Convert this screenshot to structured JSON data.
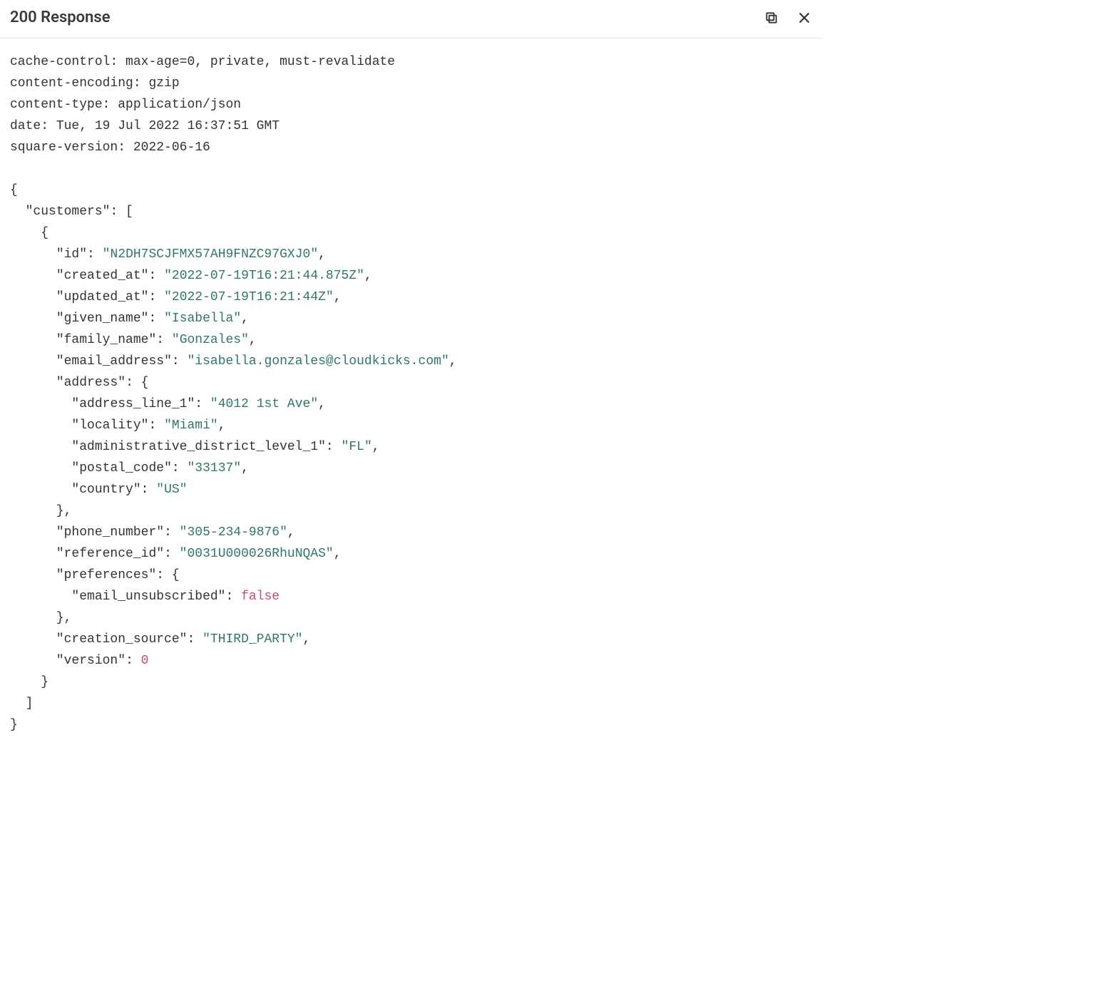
{
  "header": {
    "title": "200 Response"
  },
  "response_headers": [
    {
      "name": "cache-control",
      "value": "max-age=0, private, must-revalidate"
    },
    {
      "name": "content-encoding",
      "value": "gzip"
    },
    {
      "name": "content-type",
      "value": "application/json"
    },
    {
      "name": "date",
      "value": "Tue, 19 Jul 2022 16:37:51 GMT"
    },
    {
      "name": "square-version",
      "value": "2022-06-16"
    }
  ],
  "json": {
    "root_key": "customers",
    "fields": {
      "id": "N2DH7SCJFMX57AH9FNZC97GXJ0",
      "created_at": "2022-07-19T16:21:44.875Z",
      "updated_at": "2022-07-19T16:21:44Z",
      "given_name": "Isabella",
      "family_name": "Gonzales",
      "email_address": "isabella.gonzales@cloudkicks.com",
      "address_key": "address",
      "address": {
        "address_line_1": "4012 1st Ave",
        "locality": "Miami",
        "administrative_district_level_1": "FL",
        "postal_code": "33137",
        "country": "US"
      },
      "phone_number": "305-234-9876",
      "reference_id": "0031U000026RhuNQAS",
      "preferences_key": "preferences",
      "preferences": {
        "email_unsubscribed_key": "email_unsubscribed",
        "email_unsubscribed": "false"
      },
      "creation_source": "THIRD_PARTY",
      "version_key": "version",
      "version": "0"
    },
    "labels": {
      "id": "id",
      "created_at": "created_at",
      "updated_at": "updated_at",
      "given_name": "given_name",
      "family_name": "family_name",
      "email_address": "email_address",
      "address_line_1": "address_line_1",
      "locality": "locality",
      "administrative_district_level_1": "administrative_district_level_1",
      "postal_code": "postal_code",
      "country": "country",
      "phone_number": "phone_number",
      "reference_id": "reference_id",
      "creation_source": "creation_source"
    }
  }
}
